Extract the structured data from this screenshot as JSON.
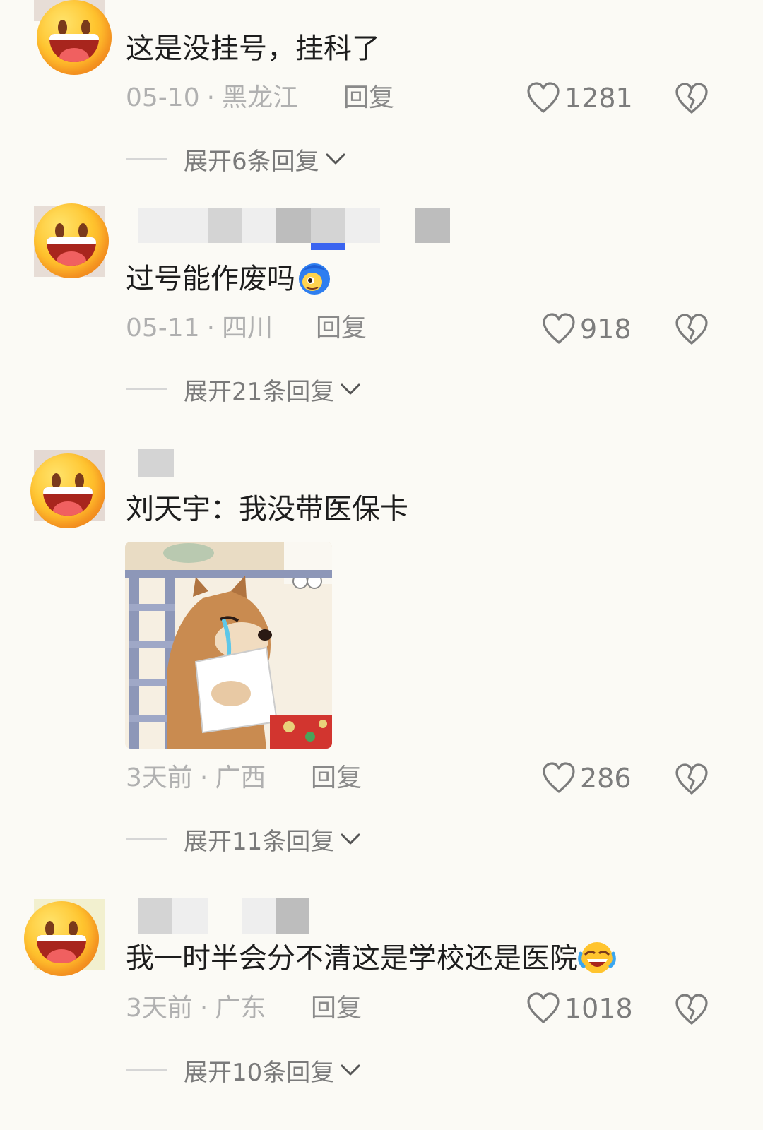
{
  "comments": [
    {
      "text": "这是没挂号，挂科了",
      "date": "05-10",
      "location": "黑龙江",
      "reply_label": "回复",
      "likes": "1281",
      "expand_label": "展开6条回复"
    },
    {
      "text": "过号能作废吗",
      "date": "05-11",
      "location": "四川",
      "reply_label": "回复",
      "likes": "918",
      "expand_label": "展开21条回复"
    },
    {
      "text": "刘天宇：我没带医保卡",
      "date": "3天前",
      "location": "广西",
      "reply_label": "回复",
      "likes": "286",
      "expand_label": "展开11条回复"
    },
    {
      "text": "我一时半会分不清这是学校还是医院",
      "date": "3天前",
      "location": "广东",
      "reply_label": "回复",
      "likes": "1018",
      "expand_label": "展开10条回复"
    }
  ],
  "separator": "·",
  "icons": {
    "avatar": "grinning-face-emoji",
    "like": "heart-outline-icon",
    "dislike": "broken-heart-icon",
    "expand": "chevron-down-icon",
    "emoji_2": "blue-hair-peeking-emoji",
    "emoji_4": "crying-laughing-emoji"
  },
  "colors": {
    "background": "#fbfaf5",
    "text": "#1d1d1d",
    "meta": "#b0b0b0",
    "action": "#7c7c7c"
  }
}
